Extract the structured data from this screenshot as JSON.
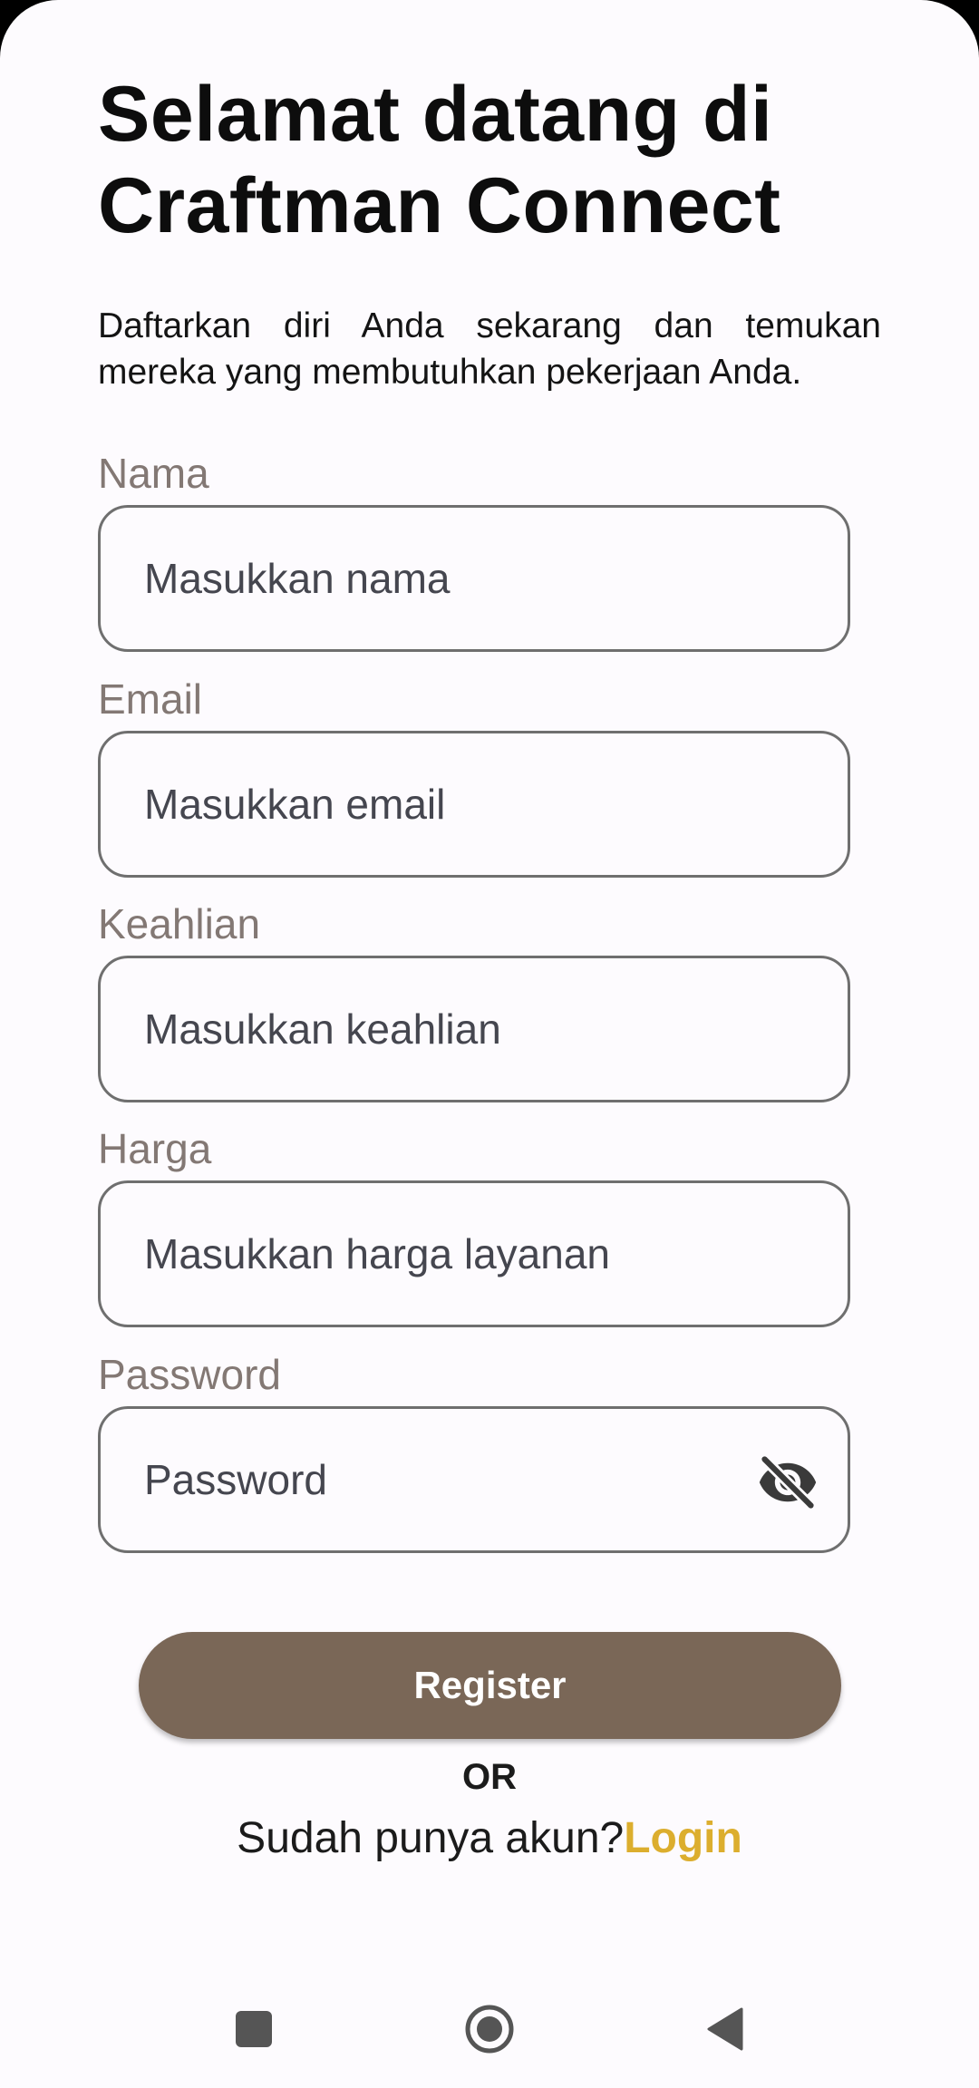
{
  "header": {
    "title": "Selamat datang di Craftman Connect",
    "subtitle": "Daftarkan diri Anda sekarang dan temukan mereka yang membutuhkan pekerjaan Anda."
  },
  "form": {
    "name": {
      "label": "Nama",
      "placeholder": "Masukkan nama",
      "value": ""
    },
    "email": {
      "label": "Email",
      "placeholder": "Masukkan email",
      "value": ""
    },
    "skill": {
      "label": "Keahlian",
      "placeholder": "Masukkan keahlian",
      "value": ""
    },
    "price": {
      "label": "Harga",
      "placeholder": "Masukkan harga layanan",
      "value": ""
    },
    "password": {
      "label": "Password",
      "placeholder": "Password",
      "value": "",
      "visibility_icon": "visibility-off-icon"
    }
  },
  "actions": {
    "register_label": "Register",
    "or_label": "OR",
    "login_prompt": "Sudah punya akun?",
    "login_label": "Login"
  },
  "nav": {
    "recents_icon": "recents-square-icon",
    "home_icon": "home-circle-icon",
    "back_icon": "back-triangle-icon"
  },
  "colors": {
    "background": "#fdfbfe",
    "primary_button": "#7a6757",
    "login_link": "#dcae2e",
    "label": "#837874",
    "field_border": "#6f6f6f"
  }
}
